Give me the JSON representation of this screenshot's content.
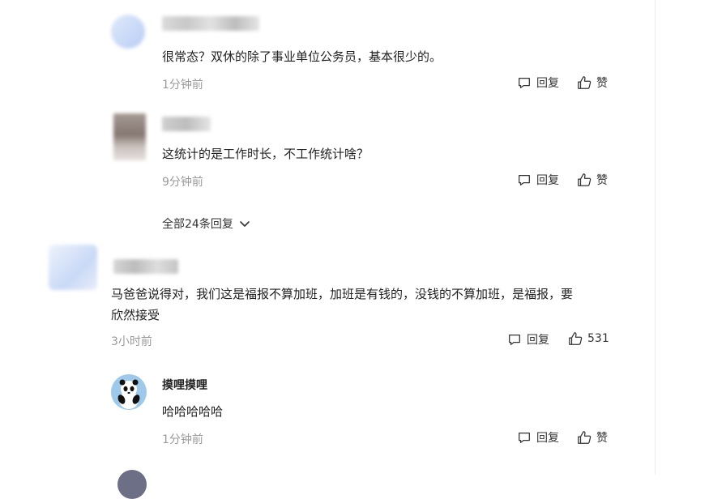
{
  "comments": [
    {
      "text": "很常态？双休的除了事业单位公务员，基本很少的。",
      "time": "1分钟前",
      "reply_label": "回复",
      "like_label": "赞"
    },
    {
      "text": "这统计的是工作时长，不工作统计啥？",
      "time": "9分钟前",
      "reply_label": "回复",
      "like_label": "赞"
    }
  ],
  "expand_label": "全部24条回复",
  "main_comment": {
    "text_line1": "马爸爸说得对，我们这是福报不算加班，加班是有钱的，没钱的不算加班，是福报，要",
    "text_line2": "欣然接受",
    "time": "3小时前",
    "reply_label": "回复",
    "like_count": "531"
  },
  "reply": {
    "username": "摸哩摸哩",
    "text": "哈哈哈哈哈",
    "time": "1分钟前",
    "reply_label": "回复",
    "like_label": "赞"
  },
  "colors": {
    "meta": "#9a9a9a",
    "text": "#222222",
    "panda_bg": "#9ec9ea"
  }
}
